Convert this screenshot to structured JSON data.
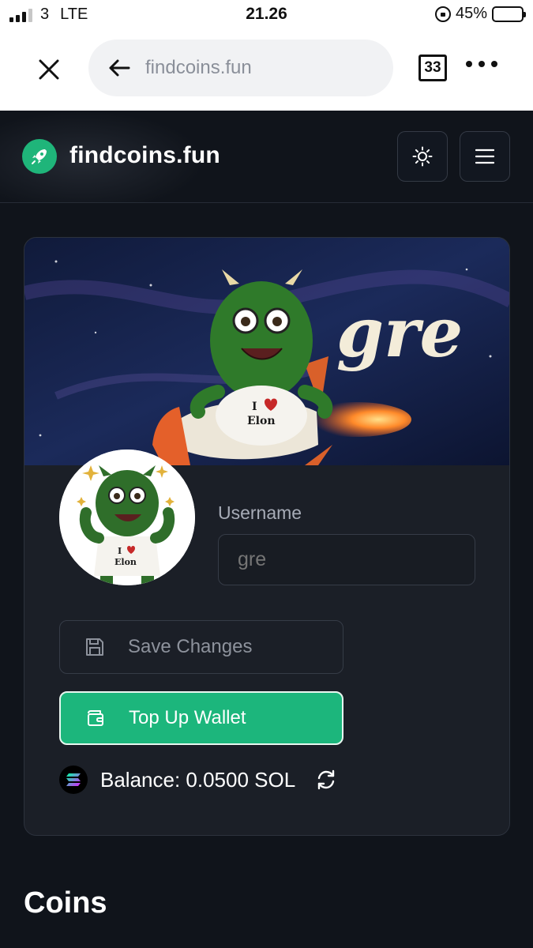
{
  "status_bar": {
    "carrier": "3",
    "network": "LTE",
    "time": "21.26",
    "battery": "45%",
    "battery_level": 0.45
  },
  "browser": {
    "url": "findcoins.fun",
    "tab_count": "33"
  },
  "site": {
    "name": "findcoins.fun"
  },
  "profile": {
    "banner_text": "gre",
    "avatar_shirt_text": "I ♥ Elon",
    "username_label": "Username",
    "username_placeholder": "gre",
    "username_value": "",
    "save_label": "Save Changes",
    "topup_label": "Top Up Wallet",
    "balance_text": "Balance: 0.0500 SOL"
  },
  "sections": {
    "coins_title": "Coins"
  },
  "colors": {
    "accent_green": "#1cb67c",
    "background": "#10141b",
    "card": "#1b1f27"
  }
}
